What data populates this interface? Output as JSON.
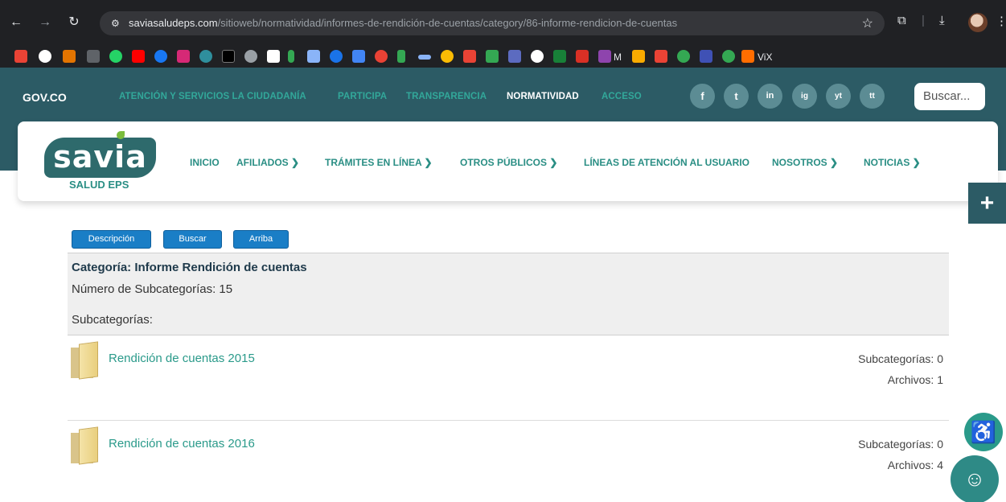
{
  "browser": {
    "url_host": "saviasaludeps.com",
    "url_path": "/sitioweb/normatividad/informes-de-rendición-de-cuentas/category/86-informe-rendicion-de-cuentas",
    "bookmark_text_1": "M",
    "bookmark_text_2": "ViX"
  },
  "govbar": {
    "logo": "GOV.CO",
    "links": [
      "ATENCIÓN Y SERVICIOS LA CIUDADANÍA",
      "PARTICIPA",
      "TRANSPARENCIA",
      "NORMATIVIDAD",
      "ACCESO"
    ],
    "social": [
      "f",
      "t",
      "in",
      "ig",
      "yt",
      "tt"
    ],
    "search_placeholder": "Buscar..."
  },
  "brand": {
    "name": "savia",
    "sub": "SALUD EPS"
  },
  "menu": [
    "INICIO",
    "AFILIADOS ❯",
    "TRÁMITES EN LÍNEA ❯",
    "OTROS PÚBLICOS ❯",
    "LÍNEAS DE ATENCIÓN AL USUARIO",
    "NOSOTROS ❯",
    "NOTICIAS ❯"
  ],
  "toolbar": {
    "descripcion": "Descripción",
    "buscar": "Buscar",
    "arriba": "Arriba"
  },
  "category": {
    "title": "Categoría: Informe Rendición de cuentas",
    "count": "Número de Subcategorías: 15",
    "subs_label": "Subcategorías:"
  },
  "subcategories": [
    {
      "name": "Rendición de cuentas 2015",
      "subcats": "Subcategorías: 0",
      "files": "Archivos: 1"
    },
    {
      "name": "Rendición de cuentas 2016",
      "subcats": "Subcategorías: 0",
      "files": "Archivos: 4"
    }
  ]
}
